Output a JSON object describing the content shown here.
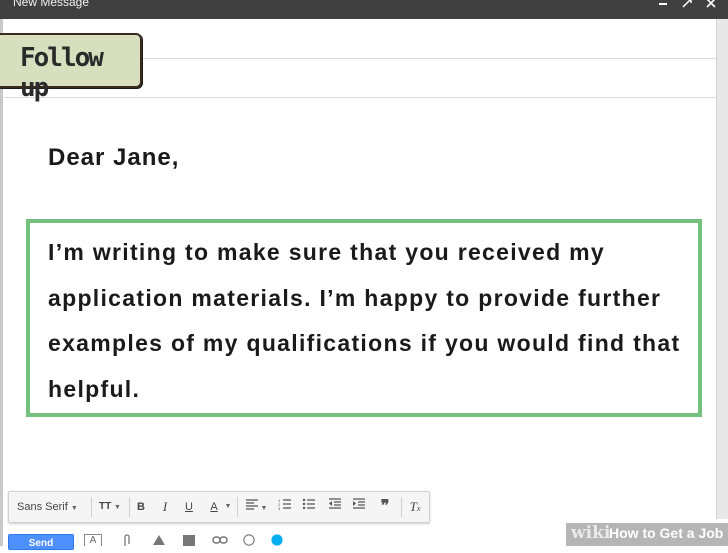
{
  "window": {
    "title": "New Message",
    "controls": [
      "minimize-icon",
      "popout-icon",
      "close-icon"
    ]
  },
  "tag": {
    "text": "Follow up"
  },
  "email": {
    "greeting": "Dear Jane,",
    "body": "I’m writing to make sure that you received my application materials. I’m happy to provide further examples of my qualifications if you would find that helpful."
  },
  "toolbar": {
    "font": "Sans Serif",
    "size_icon": "text-size-icon",
    "items": [
      "bold-icon",
      "italic-icon",
      "underline-icon",
      "text-color-icon",
      "align-icon",
      "numbered-list-icon",
      "bulleted-list-icon",
      "indent-less-icon",
      "indent-more-icon",
      "quote-icon",
      "remove-formatting-icon"
    ],
    "bold": "B",
    "italic": "I",
    "underline": "U",
    "text_color": "A"
  },
  "actions": {
    "send": "Send"
  },
  "watermark": {
    "wiki": "wiki",
    "how": "How to Get a Job"
  },
  "colors": {
    "titlebar": "#404040",
    "highlight": "#73c17c",
    "tag_bg": "#d7dfbf",
    "send": "#4d90fe"
  }
}
